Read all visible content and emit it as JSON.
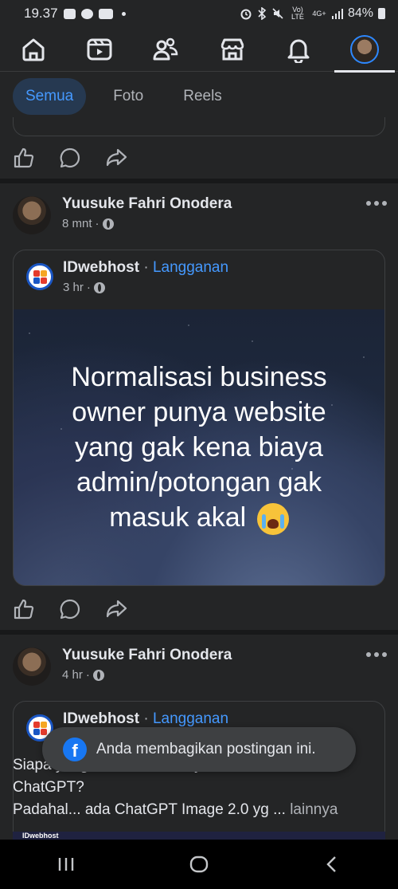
{
  "status_bar": {
    "time": "19.37",
    "network": "Vo) LTE",
    "network2": "4G+",
    "battery": "84%"
  },
  "nav": {
    "items": [
      {
        "name": "home-icon"
      },
      {
        "name": "video-icon"
      },
      {
        "name": "friends-icon"
      },
      {
        "name": "marketplace-icon"
      },
      {
        "name": "notifications-icon"
      },
      {
        "name": "profile-avatar",
        "active": true
      }
    ]
  },
  "filters": {
    "chips": [
      "Semua",
      "Foto",
      "Reels"
    ],
    "active": "Semua"
  },
  "post1": {
    "author": "Yuusuke Fahri Onodera",
    "time": "8 mnt",
    "shared": {
      "page": "IDwebhost",
      "separator": "·",
      "subscribe": "Langganan",
      "time": "3 hr",
      "text_lines": [
        "Normalisasi business",
        "owner punya website",
        "yang gak kena biaya",
        "admin/potongan gak",
        "masuk akal"
      ]
    }
  },
  "post2": {
    "author": "Yuusuke Fahri Onodera",
    "time": "4 hr",
    "shared": {
      "page": "IDwebhost",
      "separator": "·",
      "subscribe": "Langganan",
      "text_line1": "Siapa yang selama ini taunya cuma ada",
      "text_line2": "ChatGPT?",
      "text_line3": "Padahal... ada ChatGPT Image 2.0 yg ...",
      "more_label": "lainnya",
      "thumb_label": "IDwebhost"
    }
  },
  "toast": {
    "text": "Anda membagikan postingan ini."
  },
  "colors": {
    "background": "#242526",
    "accent": "#4599ff",
    "text": "#e4e6eb",
    "muted": "#b0b3b8"
  }
}
